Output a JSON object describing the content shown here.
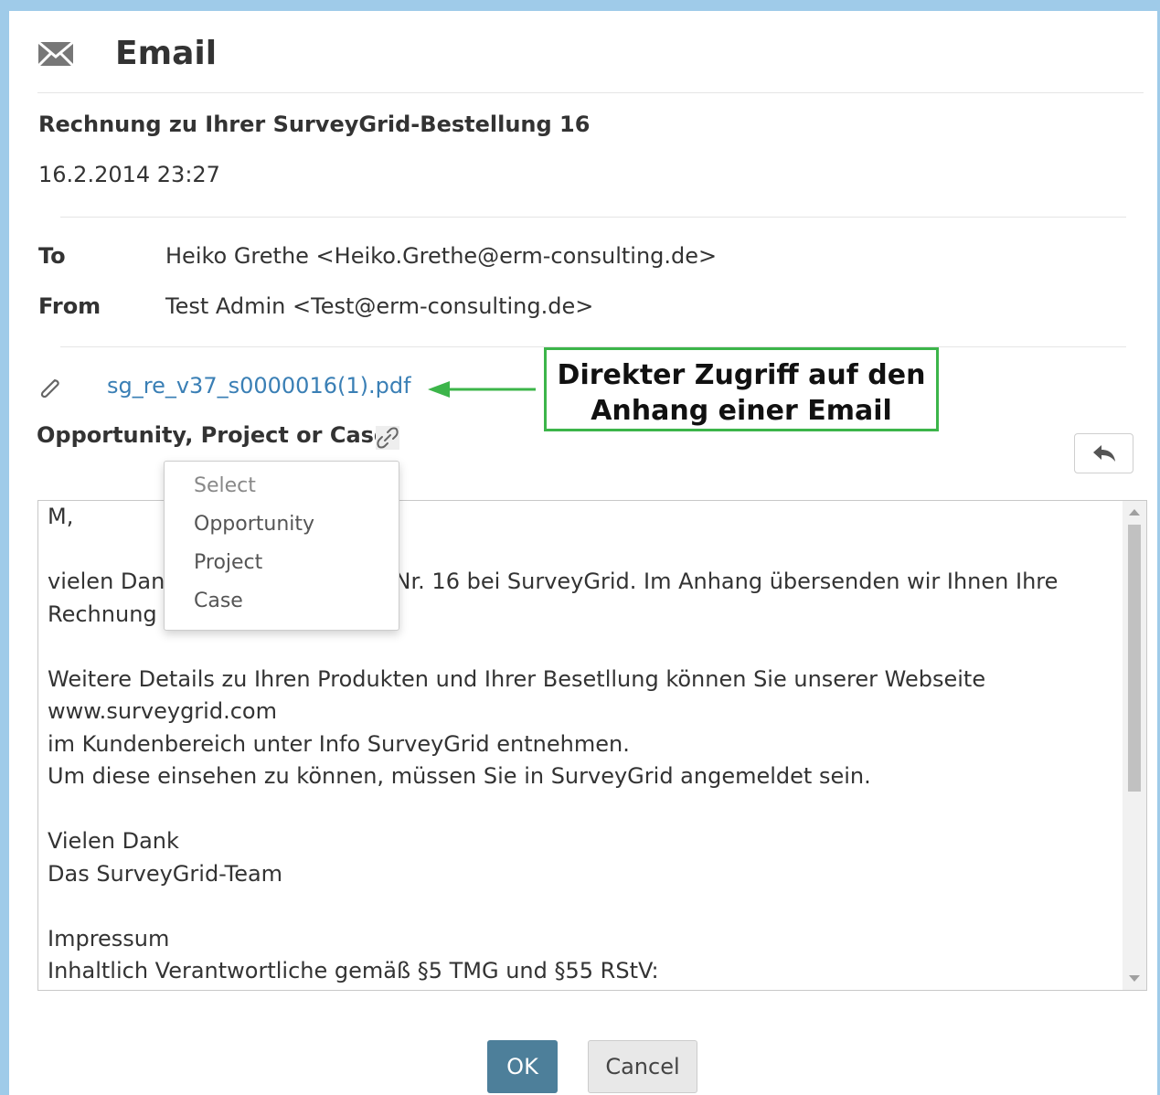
{
  "dialog": {
    "title": "Email",
    "icon": "envelope-icon"
  },
  "email": {
    "subject": "Rechnung zu Ihrer SurveyGrid-Bestellung 16",
    "date": "16.2.2014 23:27",
    "to_label": "To",
    "to_value": "Heiko Grethe <Heiko.Grethe@erm-consulting.de>",
    "from_label": "From",
    "from_value": "Test Admin <Test@erm-consulting.de>",
    "attachment": "sg_re_v37_s0000016(1).pdf"
  },
  "callout": {
    "line1": "Direkter Zugriff auf den",
    "line2": "Anhang einer Email",
    "border_color": "#3cb54a"
  },
  "link_field": {
    "label": "Opportunity, Project or Case"
  },
  "dropdown": {
    "options": [
      "Select",
      "Opportunity",
      "Project",
      "Case"
    ]
  },
  "body_lines": [
    "M,",
    "",
    "vielen Dank für Ihre Bestellung Nr. 16 bei SurveyGrid. Im Anhang übersenden wir Ihnen Ihre",
    "Rechnung zu dieser Bestellung.",
    "",
    "Weitere Details zu Ihren Produkten und Ihrer Besetllung können Sie unserer Webseite",
    "www.surveygrid.com",
    "im Kundenbereich unter Info SurveyGrid entnehmen.",
    "Um diese einsehen zu können, müssen Sie in SurveyGrid angemeldet sein.",
    "",
    "Vielen Dank",
    "Das SurveyGrid-Team",
    "",
    "Impressum",
    "Inhaltlich Verantwortliche gemäß §5 TMG und §55 RStV:"
  ],
  "buttons": {
    "ok": "OK",
    "cancel": "Cancel"
  },
  "colors": {
    "accent": "#4d7f9a",
    "link": "#3a7fb5",
    "background": "#9fcbe9"
  }
}
